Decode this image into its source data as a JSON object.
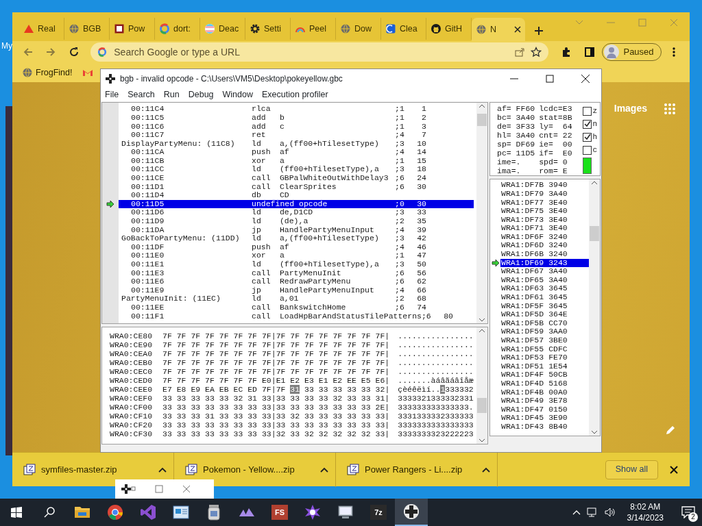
{
  "desktop": {
    "icon_label": "My"
  },
  "browser": {
    "tabs": [
      {
        "title": "Real",
        "kind": "triangle",
        "selected": false
      },
      {
        "title": "BGB",
        "kind": "globe",
        "selected": false
      },
      {
        "title": "Pow",
        "kind": "badge",
        "selected": false
      },
      {
        "title": "dort:",
        "kind": "ring",
        "selected": false
      },
      {
        "title": "Deac",
        "kind": "stripes",
        "selected": false
      },
      {
        "title": "Setti",
        "kind": "gear",
        "selected": false
      },
      {
        "title": "Peel",
        "kind": "rainbow",
        "selected": false
      },
      {
        "title": "Dow",
        "kind": "globe",
        "selected": false
      },
      {
        "title": "Clea",
        "kind": "square",
        "selected": false
      },
      {
        "title": "GitH",
        "kind": "cat",
        "selected": false
      },
      {
        "title": "N",
        "kind": "globe",
        "selected": true
      }
    ],
    "address_bar": {
      "placeholder": "Search Google or type a URL"
    },
    "profile": {
      "label": "Paused"
    },
    "bookmarks": [
      {
        "label": "FrogFind!",
        "kind": "globe"
      },
      {
        "kind": "mail"
      }
    ],
    "page": {
      "link": "Images"
    },
    "downloads": [
      {
        "filename": "symfiles-master.zip"
      },
      {
        "filename": "Pokemon - Yellow....zip"
      },
      {
        "filename": "Power Rangers - Li....zip"
      }
    ],
    "show_all": "Show all"
  },
  "debugger": {
    "title": "bgb - invalid opcode - C:\\Users\\VM5\\Desktop\\pokeyellow.gbc",
    "menu": [
      "File",
      "Search",
      "Run",
      "Debug",
      "Window",
      "Execution profiler"
    ],
    "disassembly": [
      {
        "kind": "address",
        "location": "00:11C4",
        "op": "rlca",
        "cycles": ";1",
        "total": "1",
        "selected": false
      },
      {
        "kind": "address",
        "location": "00:11C5",
        "op": "add",
        "args": "b",
        "cycles": ";1",
        "total": "2",
        "selected": false
      },
      {
        "kind": "address",
        "location": "00:11C6",
        "op": "add",
        "args": "c",
        "cycles": ";1",
        "total": "3",
        "selected": false
      },
      {
        "kind": "address",
        "location": "00:11C7",
        "op": "ret",
        "cycles": ";4",
        "total": "7",
        "selected": false
      },
      {
        "kind": "label",
        "location": "DisplayPartyMenu: (11C8)",
        "op": "ld",
        "args": "a,(ff00+hTilesetType)",
        "cycles": ";3",
        "total": "10",
        "selected": false
      },
      {
        "kind": "address",
        "location": "00:11CA",
        "op": "push",
        "args": "af",
        "cycles": ";4",
        "total": "14",
        "selected": false
      },
      {
        "kind": "address",
        "location": "00:11CB",
        "op": "xor",
        "args": "a",
        "cycles": ";1",
        "total": "15",
        "selected": false
      },
      {
        "kind": "address",
        "location": "00:11CC",
        "op": "ld",
        "args": "(ff00+hTilesetType),a",
        "cycles": ";3",
        "total": "18",
        "selected": false
      },
      {
        "kind": "address",
        "location": "00:11CE",
        "op": "call",
        "args": "GBPalWhiteOutWithDelay3",
        "cycles": ";6",
        "total": "24",
        "selected": false
      },
      {
        "kind": "address",
        "location": "00:11D1",
        "op": "call",
        "args": "ClearSprites",
        "cycles": ";6",
        "total": "30",
        "selected": false
      },
      {
        "kind": "address",
        "location": "00:11D4",
        "op": "db",
        "args": "CD",
        "selected": false
      },
      {
        "kind": "address",
        "location": "00:11D5",
        "op": "undefined opcode",
        "cycles": ";0",
        "total": "30",
        "selected": true
      },
      {
        "kind": "address",
        "location": "00:11D6",
        "op": "ld",
        "args": "de,D1CD",
        "cycles": ";3",
        "total": "33",
        "selected": false
      },
      {
        "kind": "address",
        "location": "00:11D9",
        "op": "ld",
        "args": "(de),a",
        "cycles": ";2",
        "total": "35",
        "selected": false
      },
      {
        "kind": "address",
        "location": "00:11DA",
        "op": "jp",
        "args": "HandlePartyMenuInput",
        "cycles": ";4",
        "total": "39",
        "selected": false
      },
      {
        "kind": "label",
        "location": "GoBackToPartyMenu: (11DD)",
        "op": "ld",
        "args": "a,(ff00+hTilesetType)",
        "cycles": ";3",
        "total": "42",
        "selected": false
      },
      {
        "kind": "address",
        "location": "00:11DF",
        "op": "push",
        "args": "af",
        "cycles": ";4",
        "total": "46",
        "selected": false
      },
      {
        "kind": "address",
        "location": "00:11E0",
        "op": "xor",
        "args": "a",
        "cycles": ";1",
        "total": "47",
        "selected": false
      },
      {
        "kind": "address",
        "location": "00:11E1",
        "op": "ld",
        "args": "(ff00+hTilesetType),a",
        "cycles": ";3",
        "total": "50",
        "selected": false
      },
      {
        "kind": "address",
        "location": "00:11E3",
        "op": "call",
        "args": "PartyMenuInit",
        "cycles": ";6",
        "total": "56",
        "selected": false
      },
      {
        "kind": "address",
        "location": "00:11E6",
        "op": "call",
        "args": "RedrawPartyMenu",
        "cycles": ";6",
        "total": "62",
        "selected": false
      },
      {
        "kind": "address",
        "location": "00:11E9",
        "op": "jp",
        "args": "HandlePartyMenuInput",
        "cycles": ";4",
        "total": "66",
        "selected": false
      },
      {
        "kind": "label",
        "location": "PartyMenuInit: (11EC)",
        "op": "ld",
        "args": "a,01",
        "cycles": ";2",
        "total": "68",
        "selected": false
      },
      {
        "kind": "address",
        "location": "00:11EE",
        "op": "call",
        "args": "BankswitchHome",
        "cycles": ";6",
        "total": "74",
        "selected": false
      },
      {
        "kind": "address",
        "location": "00:11F1",
        "op": "call",
        "args": "LoadHpBarAndStatusTilePatterns",
        "cycles": ";6",
        "total": "80",
        "selected": false
      }
    ],
    "hex": [
      {
        "kind": "plain",
        "address": "WRA0:CE80",
        "bytes": "7F 7F 7F 7F 7F 7F 7F 7F|7F 7F 7F 7F 7F 7F 7F 7F|",
        "ascii": "................"
      },
      {
        "kind": "plain",
        "address": "WRA0:CE90",
        "bytes": "7F 7F 7F 7F 7F 7F 7F 7F|7F 7F 7F 7F 7F 7F 7F 7F|",
        "ascii": "................"
      },
      {
        "kind": "plain",
        "address": "WRA0:CEA0",
        "bytes": "7F 7F 7F 7F 7F 7F 7F 7F|7F 7F 7F 7F 7F 7F 7F 7F|",
        "ascii": "................"
      },
      {
        "kind": "plain",
        "address": "WRA0:CEB0",
        "bytes": "7F 7F 7F 7F 7F 7F 7F 7F|7F 7F 7F 7F 7F 7F 7F 7F|",
        "ascii": "................"
      },
      {
        "kind": "plain",
        "address": "WRA0:CEC0",
        "bytes": "7F 7F 7F 7F 7F 7F 7F 7F|7F 7F 7F 7F 7F 7F 7F 7F|",
        "ascii": "................"
      },
      {
        "kind": "plain",
        "address": "WRA0:CED0",
        "bytes": "7F 7F 7F 7F 7F 7F 7F E0|E1 E2 E3 E1 E2 EE E5 E6|",
        "ascii": ".......àáâãáâîåæ"
      },
      {
        "kind": "cursor",
        "address": "WRA0:CEE0",
        "bytes_before": "E7 E8 E9 EA EB EC ED 7F|7F ",
        "cursor_byte": "31",
        "bytes_after": " 33 33 33 33 33 32|",
        "ascii_before": "çèéêëìí..",
        "ascii_cursor": "1",
        "ascii_after": "333332"
      },
      {
        "kind": "plain",
        "address": "WRA0:CEF0",
        "bytes": "33 33 33 33 33 32 31 33|33 33 33 33 32 33 33 31|",
        "ascii": "3333321333332331"
      },
      {
        "kind": "plain",
        "address": "WRA0:CF00",
        "bytes": "33 33 33 33 33 33 33 33|33 33 33 33 33 33 33 2E|",
        "ascii": "333333333333333."
      },
      {
        "kind": "plain",
        "address": "WRA0:CF10",
        "bytes": "33 33 33 31 33 33 33 33|33 32 33 33 33 33 33 33|",
        "ascii": "3331333332333333"
      },
      {
        "kind": "plain",
        "address": "WRA0:CF20",
        "bytes": "33 33 33 33 33 33 33 33|33 33 33 33 33 33 33 33|",
        "ascii": "3333333333333333"
      },
      {
        "kind": "plain",
        "address": "WRA0:CF30",
        "bytes": "33 33 33 33 33 33 33 33|32 33 32 32 32 32 32 33|",
        "ascii": "3333333323222223"
      }
    ],
    "registers": [
      {
        "left": "af= FF60",
        "right": "lcdc=E3"
      },
      {
        "left": "bc= 3A40",
        "right": "stat=8B"
      },
      {
        "left": "de= 3F33",
        "right": "ly=  64"
      },
      {
        "left": "hl= 3A40",
        "right": "cnt= 22"
      },
      {
        "left": "sp= DF69",
        "right": "ie=  00"
      },
      {
        "left": "pc= 11D5",
        "right": "if=  E0"
      },
      {
        "left": "ime=.",
        "right": "spd= 0"
      },
      {
        "left": "ima=.",
        "right": "rom= E"
      }
    ],
    "flags": [
      {
        "label": "z",
        "checked": false
      },
      {
        "label": "n",
        "checked": true
      },
      {
        "label": "h",
        "checked": true
      },
      {
        "label": "c",
        "checked": false
      }
    ],
    "stack": [
      {
        "address": "WRA1:DF7B",
        "value": "3940",
        "selected": false
      },
      {
        "address": "WRA1:DF79",
        "value": "3A40",
        "selected": false
      },
      {
        "address": "WRA1:DF77",
        "value": "3E40",
        "selected": false
      },
      {
        "address": "WRA1:DF75",
        "value": "3E40",
        "selected": false
      },
      {
        "address": "WRA1:DF73",
        "value": "3E40",
        "selected": false
      },
      {
        "address": "WRA1:DF71",
        "value": "3E40",
        "selected": false
      },
      {
        "address": "WRA1:DF6F",
        "value": "3240",
        "selected": false
      },
      {
        "address": "WRA1:DF6D",
        "value": "3240",
        "selected": false
      },
      {
        "address": "WRA1:DF6B",
        "value": "3240",
        "selected": false
      },
      {
        "address": "WRA1:DF69",
        "value": "3243",
        "selected": true
      },
      {
        "address": "WRA1:DF67",
        "value": "3A40",
        "selected": false
      },
      {
        "address": "WRA1:DF65",
        "value": "3A40",
        "selected": false
      },
      {
        "address": "WRA1:DF63",
        "value": "3645",
        "selected": false
      },
      {
        "address": "WRA1:DF61",
        "value": "3645",
        "selected": false
      },
      {
        "address": "WRA1:DF5F",
        "value": "3645",
        "selected": false
      },
      {
        "address": "WRA1:DF5D",
        "value": "364E",
        "selected": false
      },
      {
        "address": "WRA1:DF5B",
        "value": "CC70",
        "selected": false
      },
      {
        "address": "WRA1:DF59",
        "value": "3AA0",
        "selected": false
      },
      {
        "address": "WRA1:DF57",
        "value": "3BE0",
        "selected": false
      },
      {
        "address": "WRA1:DF55",
        "value": "CDFC",
        "selected": false
      },
      {
        "address": "WRA1:DF53",
        "value": "FE70",
        "selected": false
      },
      {
        "address": "WRA1:DF51",
        "value": "1E54",
        "selected": false
      },
      {
        "address": "WRA1:DF4F",
        "value": "50CB",
        "selected": false
      },
      {
        "address": "WRA1:DF4D",
        "value": "5168",
        "selected": false
      },
      {
        "address": "WRA1:DF4B",
        "value": "00A0",
        "selected": false
      },
      {
        "address": "WRA1:DF49",
        "value": "3E78",
        "selected": false
      },
      {
        "address": "WRA1:DF47",
        "value": "0150",
        "selected": false
      },
      {
        "address": "WRA1:DF45",
        "value": "3E90",
        "selected": false
      },
      {
        "address": "WRA1:DF43",
        "value": "8B40",
        "selected": false
      }
    ]
  },
  "taskbar": {
    "apps": [
      {
        "kind": "folder",
        "selected": false
      },
      {
        "kind": "browser",
        "selected": false
      },
      {
        "kind": "ribbon",
        "selected": false
      },
      {
        "kind": "window",
        "selected": false
      },
      {
        "kind": "jar",
        "selected": false
      },
      {
        "kind": "peaks",
        "selected": false
      },
      {
        "kind": "tile",
        "label": "FS",
        "selected": false
      },
      {
        "kind": "star",
        "selected": false
      },
      {
        "kind": "computer",
        "selected": false
      },
      {
        "kind": "tile",
        "label": "7z",
        "selected": false
      },
      {
        "kind": "dpad",
        "selected": true
      }
    ],
    "time": "8:02 AM",
    "date": "3/14/2023",
    "notifications": "2"
  }
}
